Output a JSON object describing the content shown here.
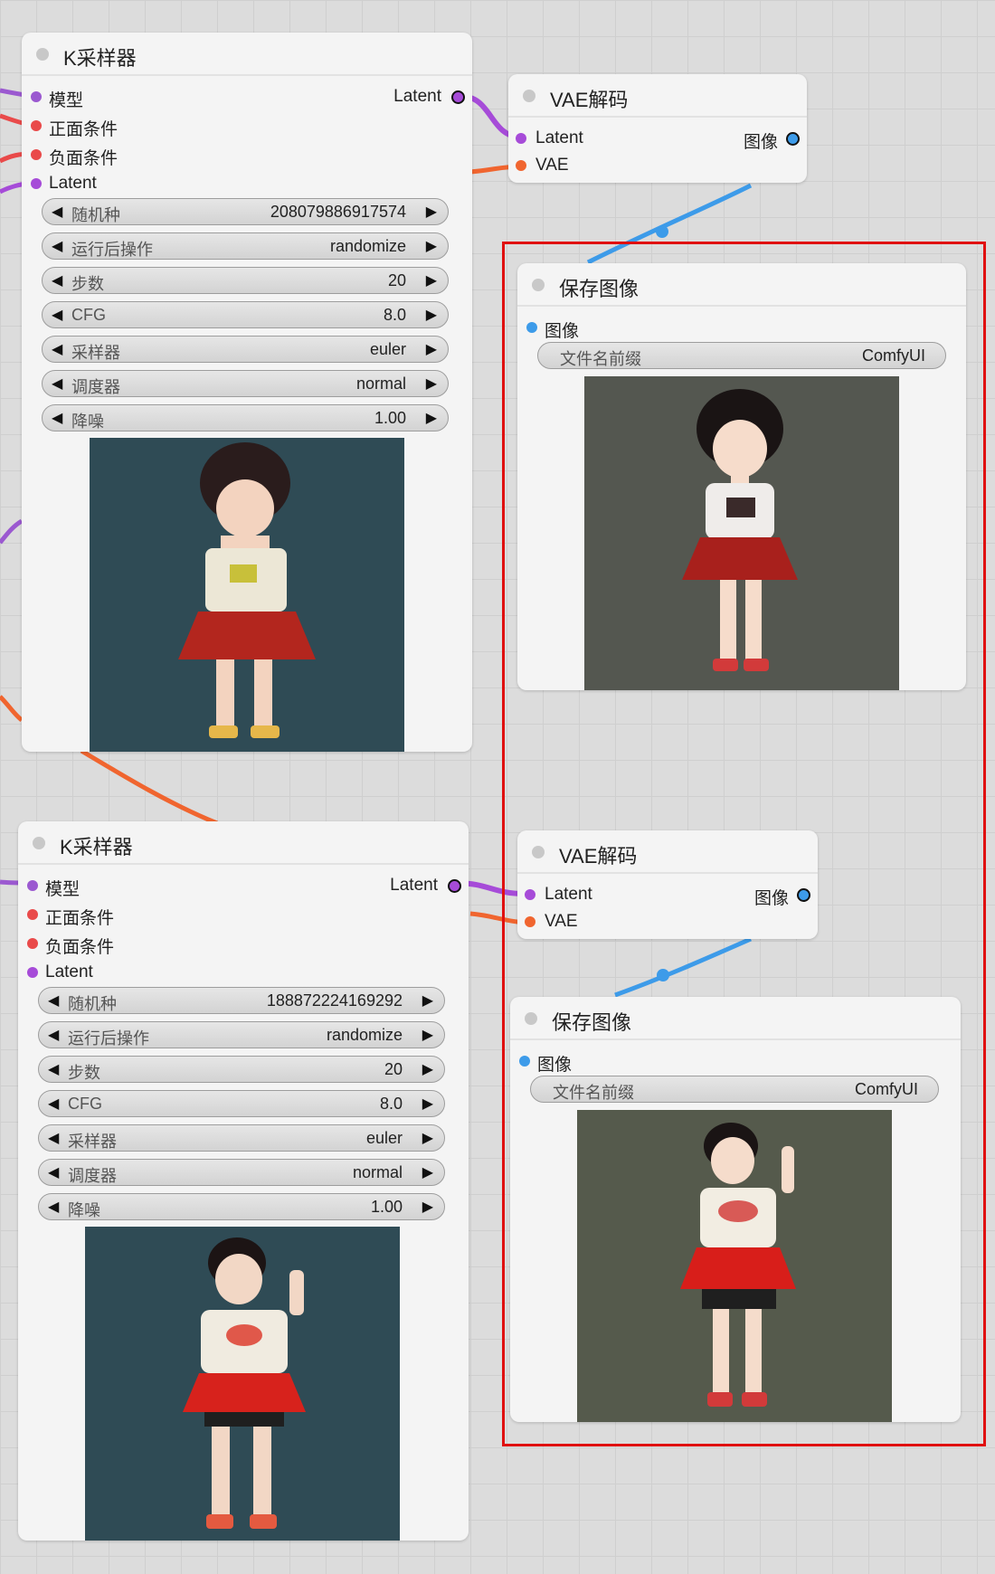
{
  "ksampler_1": {
    "title": "K采样器",
    "inputs": [
      "模型",
      "正面条件",
      "负面条件",
      "Latent"
    ],
    "output": "Latent",
    "widgets": [
      {
        "label": "随机种",
        "value": "208079886917574"
      },
      {
        "label": "运行后操作",
        "value": "randomize"
      },
      {
        "label": "步数",
        "value": "20"
      },
      {
        "label": "CFG",
        "value": "8.0"
      },
      {
        "label": "采样器",
        "value": "euler"
      },
      {
        "label": "调度器",
        "value": "normal"
      },
      {
        "label": "降噪",
        "value": "1.00"
      }
    ]
  },
  "ksampler_2": {
    "title": "K采样器",
    "inputs": [
      "模型",
      "正面条件",
      "负面条件",
      "Latent"
    ],
    "output": "Latent",
    "widgets": [
      {
        "label": "随机种",
        "value": "188872224169292"
      },
      {
        "label": "运行后操作",
        "value": "randomize"
      },
      {
        "label": "步数",
        "value": "20"
      },
      {
        "label": "CFG",
        "value": "8.0"
      },
      {
        "label": "采样器",
        "value": "euler"
      },
      {
        "label": "调度器",
        "value": "normal"
      },
      {
        "label": "降噪",
        "value": "1.00"
      }
    ]
  },
  "vae_decode_1": {
    "title": "VAE解码",
    "inputs": [
      "Latent",
      "VAE"
    ],
    "output": "图像"
  },
  "vae_decode_2": {
    "title": "VAE解码",
    "inputs": [
      "Latent",
      "VAE"
    ],
    "output": "图像"
  },
  "save_image_1": {
    "title": "保存图像",
    "input": "图像",
    "prefix_label": "文件名前缀",
    "prefix_value": "ComfyUI"
  },
  "save_image_2": {
    "title": "保存图像",
    "input": "图像",
    "prefix_label": "文件名前缀",
    "prefix_value": "ComfyUI"
  },
  "widget_arrows": {
    "left": "◀",
    "right": "▶"
  },
  "colors": {
    "model": "#9b59d0",
    "conditioning": "#e94a4a",
    "latent": "#a64bd8",
    "vae": "#f0652f",
    "image": "#3d9be9",
    "highlight": "#e01010"
  }
}
